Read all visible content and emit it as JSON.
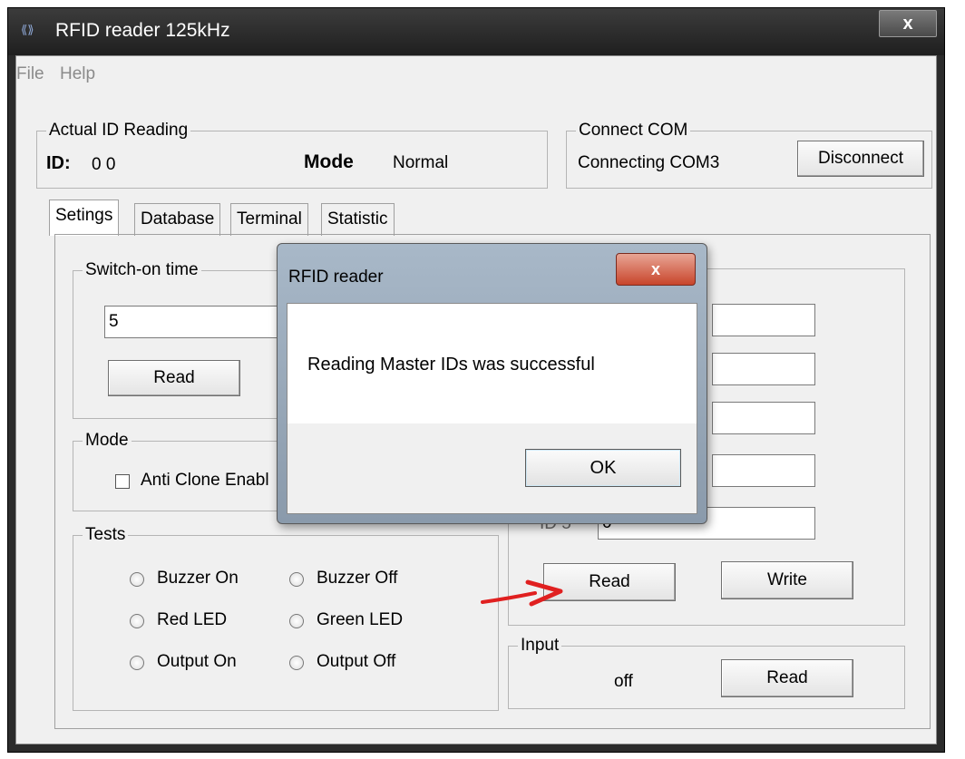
{
  "window": {
    "title": "RFID reader 125kHz",
    "close_glyph": "x"
  },
  "menu": {
    "items": [
      "File",
      "Help"
    ]
  },
  "actual_id": {
    "group_label": "Actual ID Reading",
    "id_label": "ID:",
    "id_value": "0 0",
    "mode_label": "Mode",
    "mode_value": "Normal"
  },
  "connect": {
    "group_label": "Connect COM",
    "status": "Connecting COM3",
    "button": "Disconnect"
  },
  "tabs": [
    "Setings",
    "Database",
    "Terminal",
    "Statistic"
  ],
  "switch_on": {
    "group_label": "Switch-on time",
    "value": "5",
    "read_button": "Read"
  },
  "mode": {
    "group_label": "Mode",
    "checkbox_label": "Anti Clone Enabl"
  },
  "tests": {
    "group_label": "Tests",
    "radios": [
      "Buzzer On",
      "Buzzer Off",
      "Red LED",
      "Green LED",
      "Output On",
      "Output Off"
    ]
  },
  "master_ids": {
    "id5_label": "ID 5",
    "id5_value": "0",
    "read_button": "Read",
    "write_button": "Write"
  },
  "input": {
    "group_label": "Input",
    "value": "off",
    "read_button": "Read"
  },
  "dialog": {
    "title": "RFID reader",
    "message": "Reading Master IDs was successful",
    "ok": "OK",
    "close_glyph": "x"
  },
  "colors": {
    "annotation_arrow": "#e02020",
    "titlebar": "#2b2b2b",
    "dialog_close": "#c8452b"
  }
}
